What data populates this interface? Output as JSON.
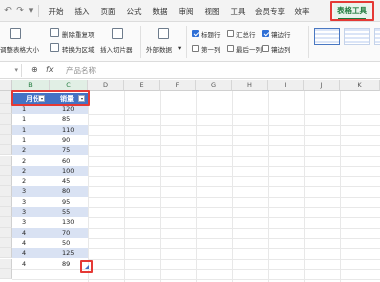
{
  "quick_access": [
    "undo-icon",
    "redo-icon",
    "dropdown-icon"
  ],
  "menu": {
    "items": [
      "开始",
      "插入",
      "页面",
      "公式",
      "数据",
      "审阅",
      "视图",
      "工具",
      "会员专享",
      "效率"
    ],
    "active": "表格工具"
  },
  "ribbon": {
    "resize_table": "调整表格大小",
    "remove_duplicates": "删除重复项",
    "convert_to_range": "转换为区域",
    "insert_slicer": "插入切片器",
    "external_data": "外部数据",
    "options": [
      {
        "label": "标题行",
        "checked": true
      },
      {
        "label": "汇总行",
        "checked": false
      },
      {
        "label": "镶边行",
        "checked": true
      },
      {
        "label": "第一列",
        "checked": false
      },
      {
        "label": "最后一列",
        "checked": false
      },
      {
        "label": "镶边列",
        "checked": false
      }
    ],
    "accent_color": "#1f7a3c",
    "style_color": "#4472c4"
  },
  "formula_bar": {
    "fx": "fx",
    "content": "产品名称"
  },
  "grid": {
    "columns": [
      "B",
      "C",
      "D",
      "E",
      "F",
      "G",
      "H",
      "I",
      "J",
      "K"
    ],
    "header_row": {
      "b": "月份",
      "c": "销量"
    },
    "rows": [
      {
        "b": "1",
        "c": "120"
      },
      {
        "b": "1",
        "c": "85"
      },
      {
        "b": "1",
        "c": "110"
      },
      {
        "b": "1",
        "c": "90"
      },
      {
        "b": "2",
        "c": "75"
      },
      {
        "b": "2",
        "c": "60"
      },
      {
        "b": "2",
        "c": "100"
      },
      {
        "b": "2",
        "c": "45"
      },
      {
        "b": "3",
        "c": "80"
      },
      {
        "b": "3",
        "c": "95"
      },
      {
        "b": "3",
        "c": "55"
      },
      {
        "b": "3",
        "c": "130"
      },
      {
        "b": "4",
        "c": "70"
      },
      {
        "b": "4",
        "c": "50"
      },
      {
        "b": "4",
        "c": "125"
      },
      {
        "b": "4",
        "c": "89"
      }
    ],
    "header_fill": "#4472c4",
    "band_fill": "#d9e2f3",
    "highlight_color": "#e53935"
  }
}
